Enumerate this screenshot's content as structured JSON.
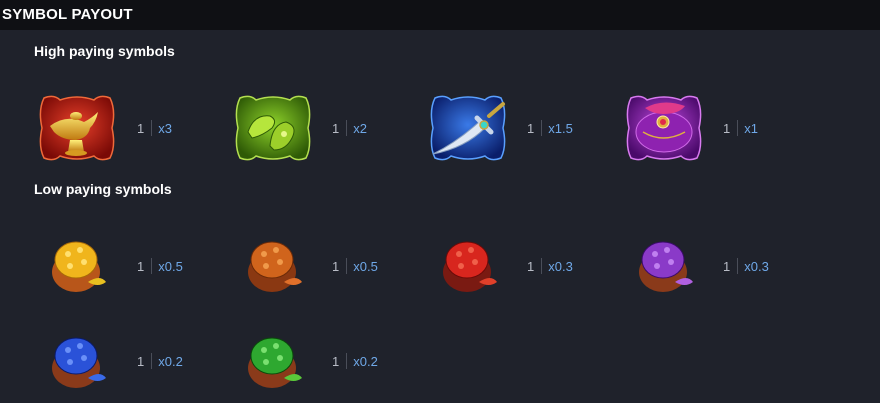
{
  "header": {
    "title": "SYMBOL PAYOUT"
  },
  "high": {
    "title": "High paying symbols",
    "items": [
      {
        "icon": "golden-lamp-icon",
        "count": "1",
        "multiplier": "x3",
        "color": "#c01a12"
      },
      {
        "icon": "green-slippers-icon",
        "count": "1",
        "multiplier": "x2",
        "color": "#6aa516"
      },
      {
        "icon": "dagger-icon",
        "count": "1",
        "multiplier": "x1.5",
        "color": "#1d4fb8"
      },
      {
        "icon": "purple-turban-icon",
        "count": "1",
        "multiplier": "x1",
        "color": "#9a27b8"
      }
    ]
  },
  "low": {
    "title": "Low paying symbols",
    "items": [
      {
        "icon": "yellow-spice-bowl-icon",
        "count": "1",
        "multiplier": "x0.5",
        "color": "#f0b51c"
      },
      {
        "icon": "orange-spice-bowl-icon",
        "count": "1",
        "multiplier": "x0.5",
        "color": "#d0641c"
      },
      {
        "icon": "red-spice-bowl-icon",
        "count": "1",
        "multiplier": "x0.3",
        "color": "#d8261e"
      },
      {
        "icon": "purple-spice-bowl-icon",
        "count": "1",
        "multiplier": "x0.3",
        "color": "#8a3ac8"
      },
      {
        "icon": "blue-spice-bowl-icon",
        "count": "1",
        "multiplier": "x0.2",
        "color": "#2a52d8"
      },
      {
        "icon": "green-spice-bowl-icon",
        "count": "1",
        "multiplier": "x0.2",
        "color": "#2ea830"
      }
    ]
  }
}
